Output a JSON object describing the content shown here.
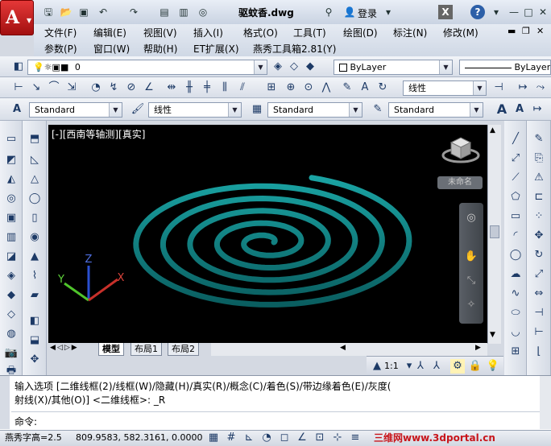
{
  "title": {
    "filename": "驱蚊香.dwg",
    "login": "登录",
    "help": "?",
    "window_controls": [
      "—",
      "□",
      "✕"
    ]
  },
  "menus": {
    "row1": [
      "文件(F)",
      "编辑(E)",
      "视图(V)",
      "插入(I)",
      "格式(O)",
      "工具(T)",
      "绘图(D)",
      "标注(N)",
      "修改(M)"
    ],
    "row2": [
      "参数(P)",
      "窗口(W)",
      "帮助(H)",
      "ET扩展(X)",
      "燕秀工具箱2.81(Y)"
    ]
  },
  "layer": {
    "current": "0"
  },
  "properties": {
    "color": "ByLayer",
    "linetype": "ByLayer",
    "linetype_combo": "线性"
  },
  "styles": {
    "text": "Standard",
    "dim": "线性",
    "table": "Standard",
    "multileader": "Standard"
  },
  "viewport": {
    "label": "[-][西南等轴测][真实]"
  },
  "viewcube": {
    "label": "未命名"
  },
  "layout_tabs": [
    "模型",
    "布局1",
    "布局2"
  ],
  "command": {
    "history1": "输入选项 [二维线框(2)/线框(W)/隐藏(H)/真实(R)/概念(C)/着色(S)/带边缘着色(E)/灰度(",
    "history2": "射线(X)/其他(O)] <二维线框>: _R",
    "prompt": "命令:"
  },
  "status": {
    "font_height": "燕秀字高=2.5",
    "coords": "809.9583, 582.3161, 0.0000",
    "scale": "1:1",
    "watermark": "三维网www.3dportal.cn"
  },
  "ucs": {
    "x": "X",
    "y": "Y",
    "z": "Z"
  },
  "colors": {
    "spiral": "#0f7f80",
    "canvas": "#000000",
    "accent": "#c8151b"
  }
}
